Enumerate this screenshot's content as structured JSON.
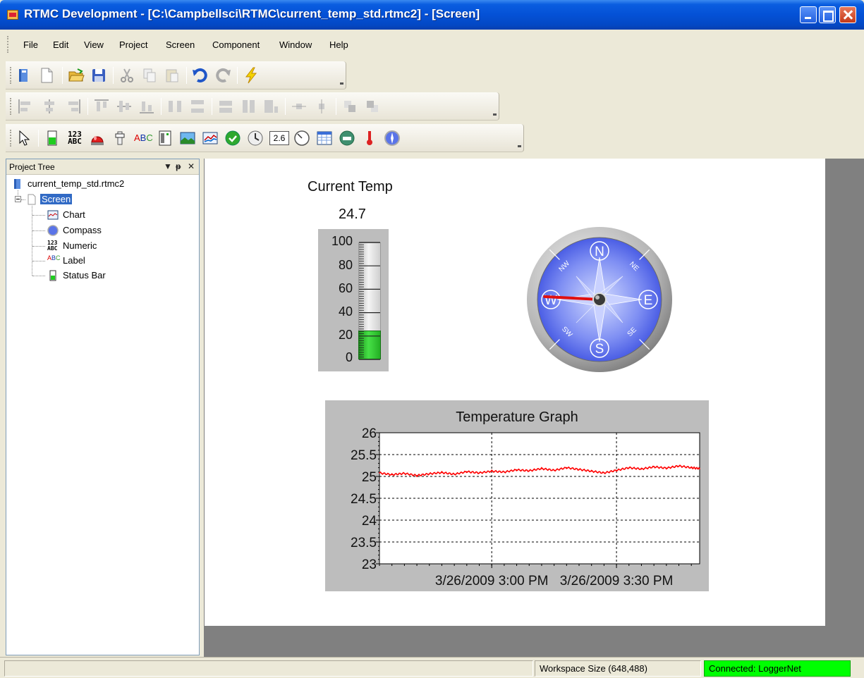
{
  "window": {
    "title": "RTMC Development - [C:\\Campbellsci\\RTMC\\current_temp_std.rtmc2] - [Screen]"
  },
  "menu": {
    "items": [
      "File",
      "Edit",
      "View",
      "Project",
      "Screen",
      "Component",
      "Window",
      "Help"
    ]
  },
  "toolbars": {
    "standard": [
      "new-project-icon",
      "new-screen-icon",
      "open-icon",
      "save-icon",
      "cut-icon",
      "copy-icon",
      "paste-icon",
      "undo-icon",
      "redo-icon",
      "run-icon"
    ],
    "alignment": [
      "align-left-icon",
      "align-center-icon",
      "align-right-icon",
      "align-top-icon",
      "align-middle-icon",
      "align-bottom-icon",
      "space-horizontal-icon",
      "space-vertical-icon",
      "same-width-icon",
      "same-height-icon",
      "same-size-icon",
      "center-horizontal-icon",
      "center-vertical-icon",
      "bring-front-icon",
      "send-back-icon"
    ],
    "components": [
      "pointer-icon",
      "status-bar-icon",
      "numeric-icon",
      "alarm-icon",
      "switch-icon",
      "label-icon",
      "digital-icon",
      "image-icon",
      "chart-icon",
      "indicator-icon",
      "clock-icon",
      "numeric-display-icon",
      "gauge-icon",
      "table-icon",
      "odometer-icon",
      "thermometer-icon",
      "compass-icon"
    ],
    "numeric_display_value": "2.6",
    "numeric_icon_text": "123\nABC",
    "label_icon_text": "ABC"
  },
  "project_tree": {
    "title": "Project Tree",
    "buttons": [
      "▼",
      "ᵽ",
      "✕"
    ],
    "root": "current_temp_std.rtmc2",
    "screen": "Screen",
    "children": [
      "Chart",
      "Compass",
      "Numeric",
      "Label",
      "Status Bar"
    ],
    "numeric_icon_text": "123\nABC"
  },
  "canvas": {
    "label_text": "Current Temp",
    "numeric_value": "24.7",
    "status_bar": {
      "ticks": [
        "100",
        "80",
        "60",
        "40",
        "20",
        "0"
      ],
      "value": 24.7,
      "min": 0,
      "max": 100
    },
    "compass": {
      "cardinals": [
        "N",
        "E",
        "S",
        "W"
      ],
      "ordinals": [
        "NE",
        "SE",
        "SW",
        "NW"
      ],
      "heading_deg": 273
    }
  },
  "chart_data": {
    "type": "line",
    "title": "Temperature Graph",
    "xlabel": "",
    "ylabel": "",
    "ylim": [
      23,
      26
    ],
    "yticks": [
      "26",
      "25.5",
      "25",
      "24.5",
      "24",
      "23.5",
      "23"
    ],
    "xticks": [
      "3/26/2009 3:00 PM",
      "3/26/2009 3:30 PM"
    ],
    "x_range_minutes": [
      -27,
      50
    ],
    "xtick_minutes": [
      0,
      30
    ],
    "grid": true,
    "series": [
      {
        "color": "#ff0000",
        "x_minutes": [
          -27,
          -24,
          -21,
          -18,
          -15,
          -12,
          -9,
          -6,
          -3,
          0,
          3,
          6,
          9,
          12,
          15,
          18,
          21,
          24,
          27,
          30,
          33,
          36,
          39,
          42,
          45,
          48,
          50
        ],
        "values": [
          25.08,
          25.04,
          25.07,
          25.02,
          25.06,
          25.09,
          25.05,
          25.11,
          25.08,
          25.12,
          25.1,
          25.15,
          25.13,
          25.18,
          25.14,
          25.2,
          25.16,
          25.12,
          25.08,
          25.14,
          25.2,
          25.17,
          25.22,
          25.19,
          25.24,
          25.2,
          25.18
        ]
      }
    ]
  },
  "statusbar": {
    "workspace": "Workspace Size (648,488)",
    "connection": "Connected: LoggerNet"
  }
}
